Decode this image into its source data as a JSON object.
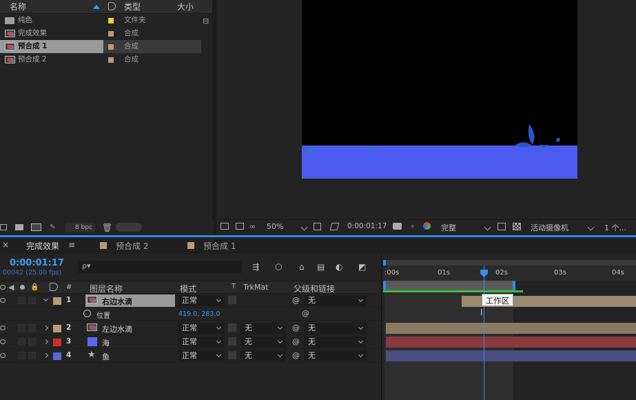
{
  "project": {
    "headers": {
      "name": "名称",
      "type": "类型",
      "size": "大小"
    },
    "items": [
      {
        "name": "纯色",
        "type": "文件夹",
        "color": "#e6d23c",
        "icon": "folder-icon"
      },
      {
        "name": "完成效果",
        "type": "合成",
        "color": "#b89a78",
        "icon": "composition-icon"
      },
      {
        "name": "预合成 1",
        "type": "合成",
        "color": "#b89a78",
        "icon": "composition-icon",
        "selected": true
      },
      {
        "name": "预合成 2",
        "type": "合成",
        "color": "#b89a78",
        "icon": "composition-icon"
      }
    ],
    "bpc": "8 bpc"
  },
  "viewer": {
    "zoom": "50%",
    "timecode": "0:00:01:17",
    "resolution": "完整",
    "camera": "活动摄像机",
    "views": "1 个..."
  },
  "timeline": {
    "tabs": [
      {
        "label": "完成效果",
        "active": true
      },
      {
        "label": "预合成 2",
        "active": false
      },
      {
        "label": "预合成 1",
        "active": false
      }
    ],
    "current_time": "0:00:01:17",
    "frames": "00042 (25.00 fps)",
    "search_placeholder": "ρ▾",
    "columns": {
      "num": "#",
      "layer_name": "图层名称",
      "mode": "模式",
      "t": "T",
      "trkmat": "TrkMat",
      "parent": "父级和链接"
    },
    "layers": [
      {
        "num": "1",
        "name": "右边水滴",
        "mode": "正常",
        "trkmat": "",
        "parent": "无",
        "color": "#b89a78",
        "selected": true,
        "bar_color": "#9a8a70"
      },
      {
        "num": "2",
        "name": "左边水滴",
        "mode": "正常",
        "trkmat": "无",
        "parent": "无",
        "color": "#b89a78",
        "bar_color": "#8a7a64"
      },
      {
        "num": "3",
        "name": "海",
        "mode": "正常",
        "trkmat": "无",
        "parent": "无",
        "color": "#d03030",
        "bar_color": "#8a3a3e"
      },
      {
        "num": "4",
        "name": "鱼",
        "mode": "正常",
        "trkmat": "无",
        "parent": "无",
        "color": "#5a68d8",
        "bar_color": "#4a4e80"
      }
    ],
    "property": {
      "name": "位置",
      "value": "419.0, 283.0"
    },
    "ruler": [
      ":00s",
      "01s",
      "02s",
      "03s",
      "04s"
    ],
    "tooltip": "工作区"
  }
}
